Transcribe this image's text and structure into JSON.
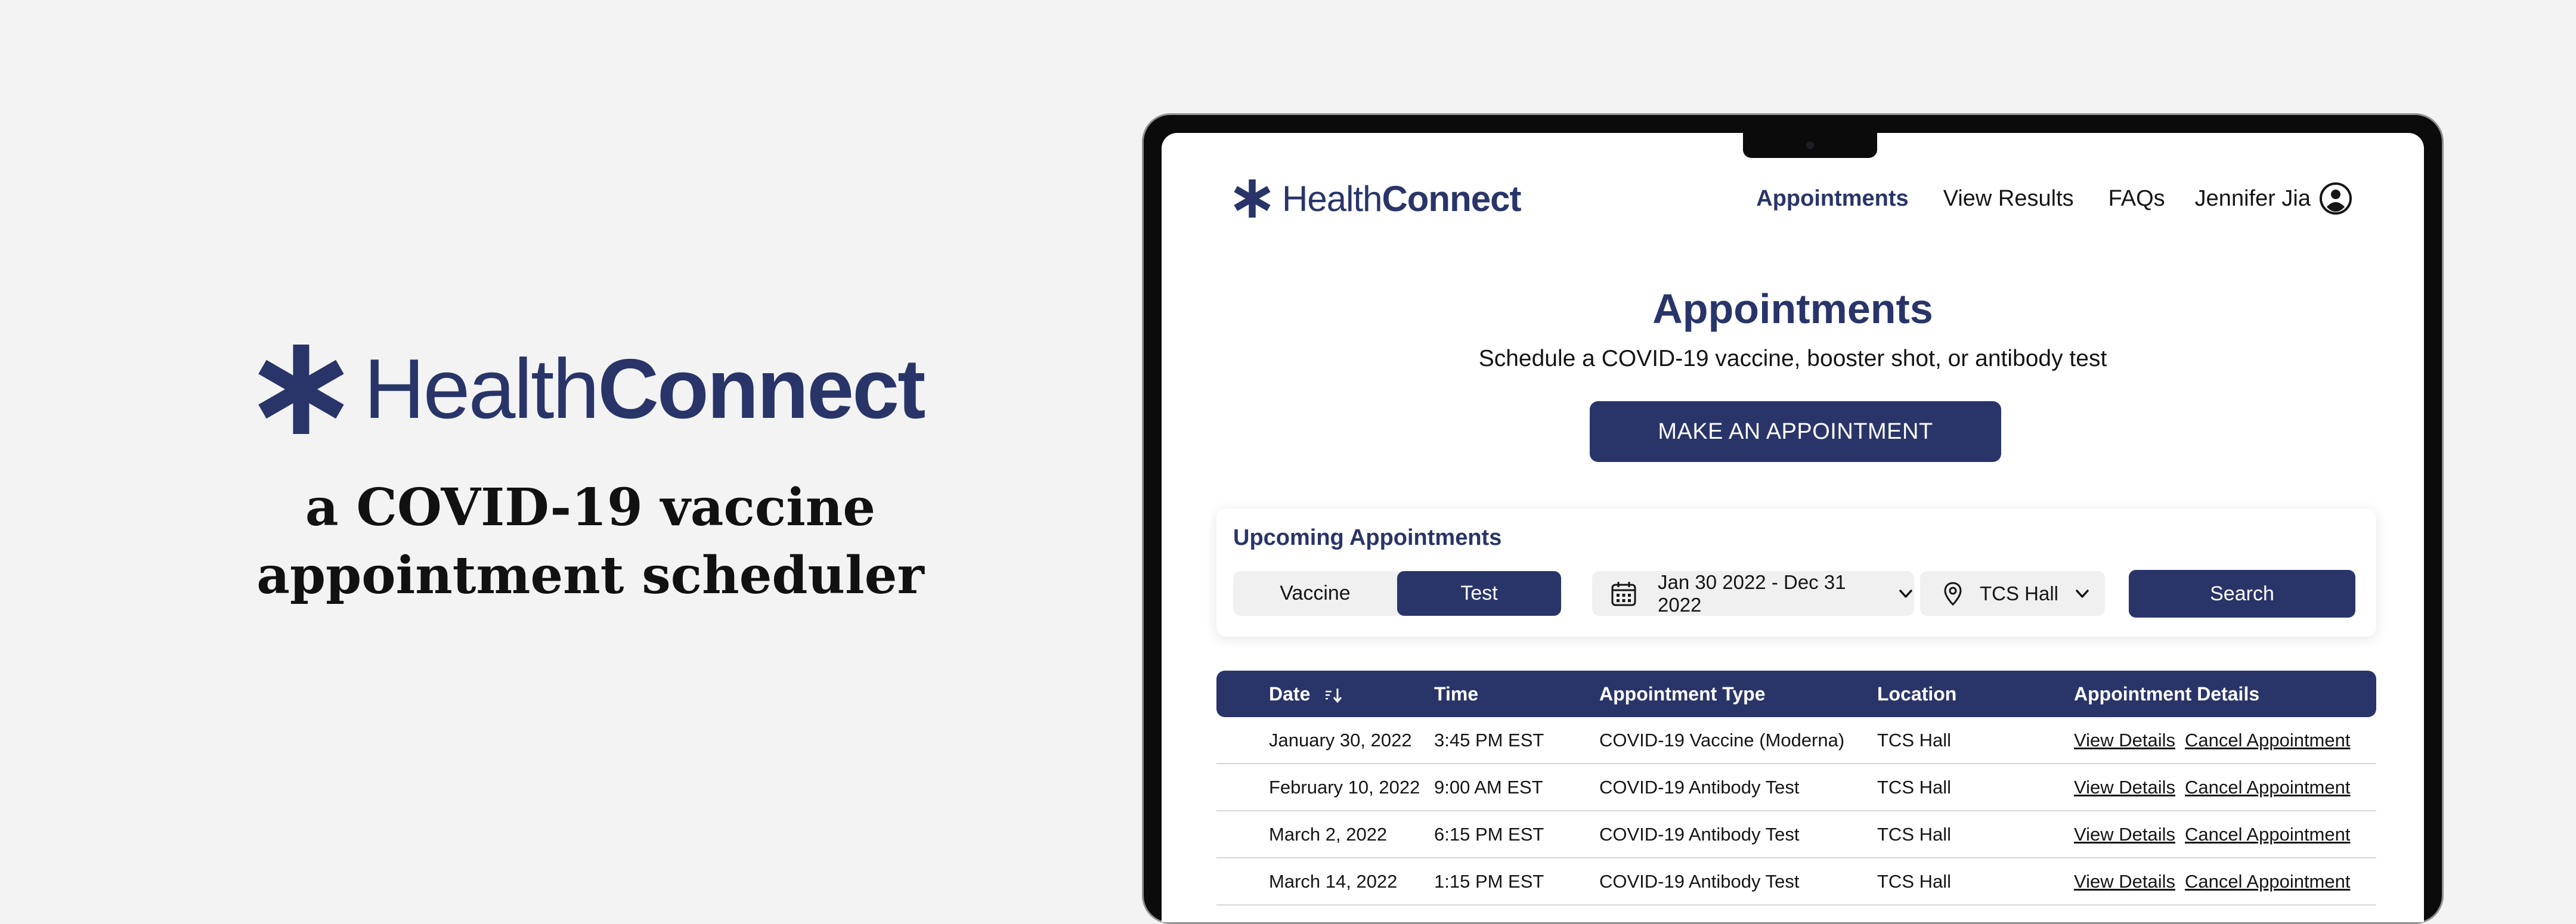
{
  "brand": {
    "name_light": "Health",
    "name_bold": "Connect",
    "tagline_line1": "a COVID-19 vaccine",
    "tagline_line2": "appointment scheduler"
  },
  "colors": {
    "primary": "#293569",
    "background": "#f3f3f3",
    "panel": "#f0f0f0"
  },
  "nav": {
    "items": [
      {
        "label": "Appointments",
        "active": true
      },
      {
        "label": "View Results"
      },
      {
        "label": "FAQs"
      }
    ],
    "user_name": "Jennifer Jia"
  },
  "hero": {
    "title": "Appointments",
    "subtitle": "Schedule a COVID-19 vaccine, booster shot, or antibody test",
    "cta_label": "MAKE AN APPOINTMENT"
  },
  "filters": {
    "title": "Upcoming Appointments",
    "toggle": [
      "Vaccine",
      "Test"
    ],
    "selected": "Test",
    "date_range": "Jan 30 2022 - Dec 31 2022",
    "location": "TCS Hall",
    "search_label": "Search"
  },
  "table": {
    "headers": [
      "Date",
      "Time",
      "Appointment Type",
      "Location",
      "Appointment Details"
    ],
    "rows": [
      {
        "date": "January 30, 2022",
        "time": "3:45 PM EST",
        "type": "COVID-19 Vaccine (Moderna)",
        "location": "TCS Hall"
      },
      {
        "date": "February 10, 2022",
        "time": "9:00 AM EST",
        "type": "COVID-19 Antibody Test",
        "location": "TCS Hall"
      },
      {
        "date": "March 2, 2022",
        "time": "6:15 PM EST",
        "type": "COVID-19 Antibody Test",
        "location": "TCS Hall"
      },
      {
        "date": "March 14, 2022",
        "time": "1:15 PM EST",
        "type": "COVID-19 Antibody Test",
        "location": "TCS Hall"
      }
    ],
    "view_label": "View Details",
    "cancel_label": "Cancel Appointment"
  }
}
